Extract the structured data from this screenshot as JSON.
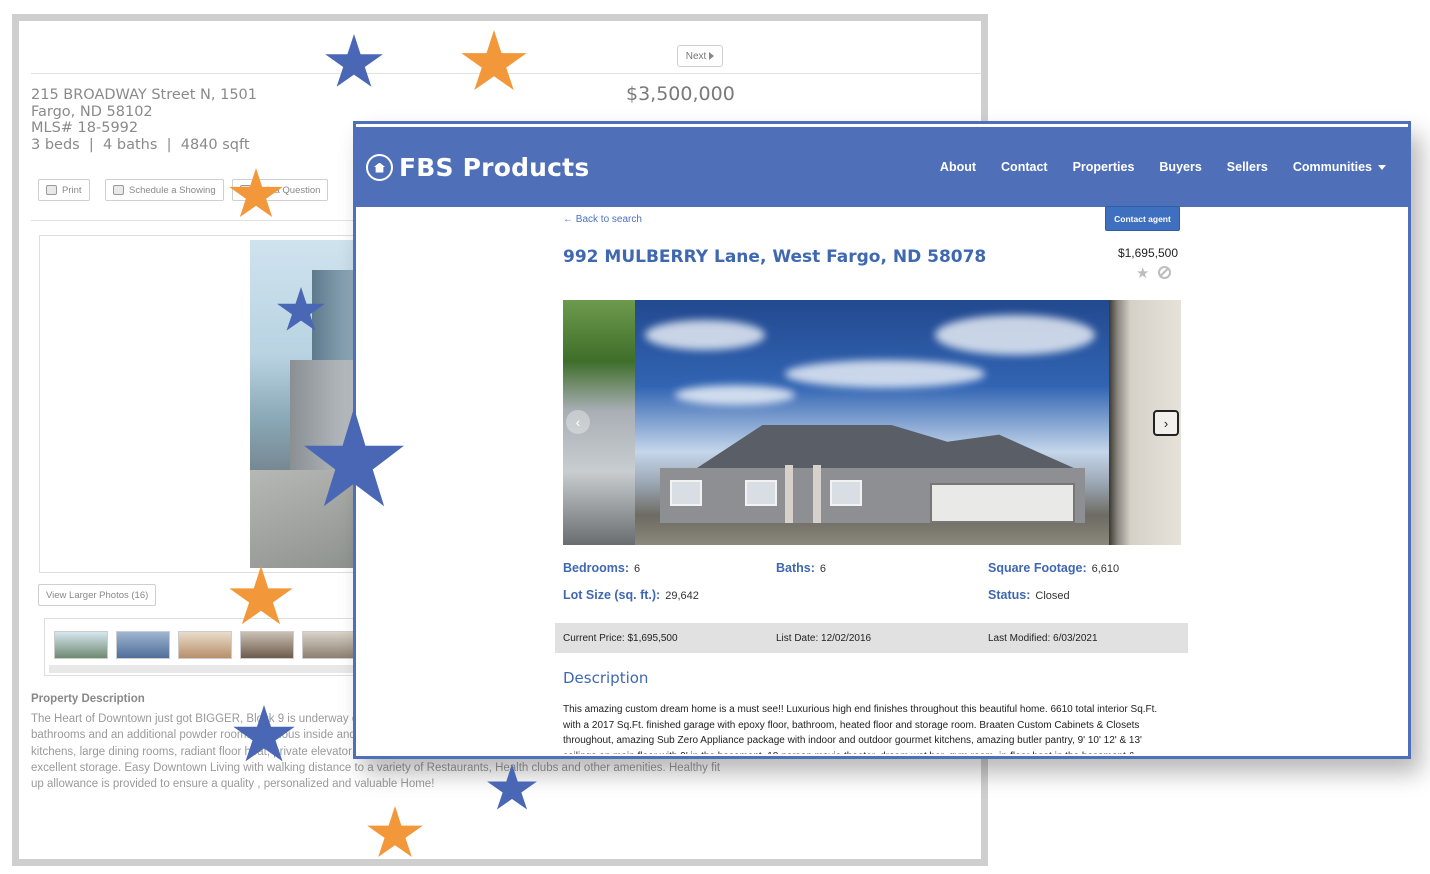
{
  "back_page": {
    "next_label": "Next",
    "address_line1": "215 BROADWAY Street N, 1501",
    "address_line2": "Fargo, ND 58102",
    "mls": "MLS# 18-5992",
    "stats": "3 beds  |  4 baths  |  4840 sqft",
    "price": "$3,500,000",
    "buttons": {
      "print": "Print",
      "schedule": "Schedule a Showing",
      "question": "Ask a Question"
    },
    "view_larger": "View Larger Photos (16)",
    "description_title": "Property Description",
    "description": "The Heart of Downtown just got BIGGER, Block 9 is underway on the 16th floor w/unique designs. Interiors can be modified, custom bathrooms and an additional powder room. Spacious inside and out. Watch the Sunrise or Sunset over the Red River Valley. Open kitchens, large dining rooms, radiant floor heat, private elevator access ,underground heated parking w/private entrance, interior dog run, excellent storage. Easy Downtown Living with walking distance to a variety of Restaurants, Health clubs and other amenities. Healthy fit up allowance is provided to ensure a quality , personalized and valuable Home!"
  },
  "front_page": {
    "brand": "FBS Products",
    "nav": [
      "About",
      "Contact",
      "Properties",
      "Buyers",
      "Sellers",
      "Communities"
    ],
    "back_link": "← Back to search",
    "contact_agent": "Contact agent",
    "title": "992 MULBERRY Lane, West Fargo, ND 58078",
    "price": "$1,695,500",
    "gallery": {
      "prev": "‹",
      "next": "›"
    },
    "facts": {
      "bedrooms_label": "Bedrooms:",
      "bedrooms": "6",
      "baths_label": "Baths:",
      "baths": "6",
      "sqft_label": "Square Footage:",
      "sqft": "6,610",
      "lot_label": "Lot Size (sq. ft.):",
      "lot": "29,642",
      "status_label": "Status:",
      "status": "Closed"
    },
    "summary": {
      "current_price_label": "Current Price:",
      "current_price": "$1,695,500",
      "list_date_label": "List Date:",
      "list_date": "12/02/2016",
      "last_modified_label": "Last Modified:",
      "last_modified": "6/03/2021"
    },
    "description_title": "Description",
    "description": "This amazing custom dream home is a must see!! Luxurious high end finishes throughout this beautiful home. 6610 total interior Sq.Ft. with a 2017 Sq.Ft. finished garage with epoxy floor, bathroom, heated floor and storage room. Braaten Custom Cabinets & Closets throughout, amazing Sub Zero Appliance package with indoor and outdoor gourmet kitchens, amazing butler pantry, 9' 10' 12' & 13' ceilings on main floor with 9' in the basement, 18 person movie theater, dream wet bar, gym room, in-floor heat in the basement &"
  },
  "colors": {
    "brand_blue": "#4f70b9",
    "link_blue": "#3f68b0",
    "star_blue": "#4a67b5",
    "star_orange": "#f2983a"
  },
  "icons": [
    "home-logo-icon",
    "caret-down-icon",
    "favorite-star-icon",
    "hide-ban-icon",
    "print-icon",
    "calendar-icon",
    "question-icon",
    "star-decoration"
  ]
}
